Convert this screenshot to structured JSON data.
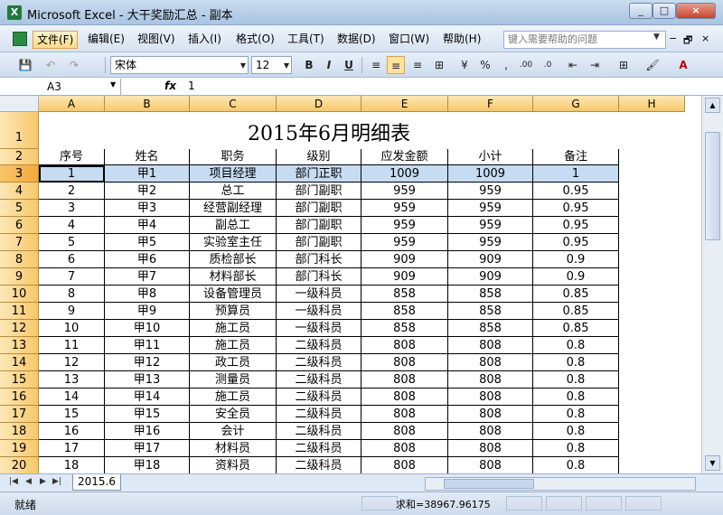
{
  "window": {
    "title": "Microsoft Excel - 大干奖励汇总 - 副本",
    "app_icon": "excel-icon",
    "buttons": [
      "_",
      "□",
      "×"
    ]
  },
  "menubar": {
    "items": [
      "文件(F)",
      "编辑(E)",
      "视图(V)",
      "插入(I)",
      "格式(O)",
      "工具(T)",
      "数据(D)",
      "窗口(W)",
      "帮助(H)"
    ],
    "help_placeholder": "键入需要帮助的问题",
    "mdi_controls": [
      "−",
      "🗗",
      "×"
    ]
  },
  "toolbar": {
    "font_name": "宋体",
    "font_size": "12",
    "bold": "B",
    "italic": "I",
    "underline": "U",
    "percent": "%",
    "comma": ","
  },
  "formulabar": {
    "name_box": "A3",
    "fx": "fx",
    "value": "1"
  },
  "grid": {
    "columns": [
      "A",
      "B",
      "C",
      "D",
      "E",
      "F",
      "G",
      "H"
    ],
    "row_numbers": [
      "1",
      "2",
      "3",
      "4",
      "5",
      "6",
      "7",
      "8",
      "9",
      "10",
      "11",
      "12",
      "13",
      "14",
      "15",
      "16",
      "17",
      "18",
      "19",
      "20"
    ],
    "title": "2015年6月明细表",
    "headers": [
      "序号",
      "姓名",
      "职务",
      "级别",
      "应发金额",
      "小计",
      "备注"
    ],
    "rows": [
      [
        "1",
        "甲1",
        "项目经理",
        "部门正职",
        "1009",
        "1009",
        "1"
      ],
      [
        "2",
        "甲2",
        "总工",
        "部门副职",
        "959",
        "959",
        "0.95"
      ],
      [
        "3",
        "甲3",
        "经营副经理",
        "部门副职",
        "959",
        "959",
        "0.95"
      ],
      [
        "4",
        "甲4",
        "副总工",
        "部门副职",
        "959",
        "959",
        "0.95"
      ],
      [
        "5",
        "甲5",
        "实验室主任",
        "部门副职",
        "959",
        "959",
        "0.95"
      ],
      [
        "6",
        "甲6",
        "质检部长",
        "部门科长",
        "909",
        "909",
        "0.9"
      ],
      [
        "7",
        "甲7",
        "材料部长",
        "部门科长",
        "909",
        "909",
        "0.9"
      ],
      [
        "8",
        "甲8",
        "设备管理员",
        "一级科员",
        "858",
        "858",
        "0.85"
      ],
      [
        "9",
        "甲9",
        "预算员",
        "一级科员",
        "858",
        "858",
        "0.85"
      ],
      [
        "10",
        "甲10",
        "施工员",
        "一级科员",
        "858",
        "858",
        "0.85"
      ],
      [
        "11",
        "甲11",
        "施工员",
        "二级科员",
        "808",
        "808",
        "0.8"
      ],
      [
        "12",
        "甲12",
        "政工员",
        "二级科员",
        "808",
        "808",
        "0.8"
      ],
      [
        "13",
        "甲13",
        "测量员",
        "二级科员",
        "808",
        "808",
        "0.8"
      ],
      [
        "14",
        "甲14",
        "施工员",
        "二级科员",
        "808",
        "808",
        "0.8"
      ],
      [
        "15",
        "甲15",
        "安全员",
        "二级科员",
        "808",
        "808",
        "0.8"
      ],
      [
        "16",
        "甲16",
        "会计",
        "二级科员",
        "808",
        "808",
        "0.8"
      ],
      [
        "17",
        "甲17",
        "材料员",
        "二级科员",
        "808",
        "808",
        "0.8"
      ],
      [
        "18",
        "甲18",
        "资料员",
        "二级科员",
        "808",
        "808",
        "0.8"
      ]
    ]
  },
  "sheet_tab": "2015.6",
  "status": {
    "ready": "就绪",
    "sum": "求和=38967.96175"
  }
}
